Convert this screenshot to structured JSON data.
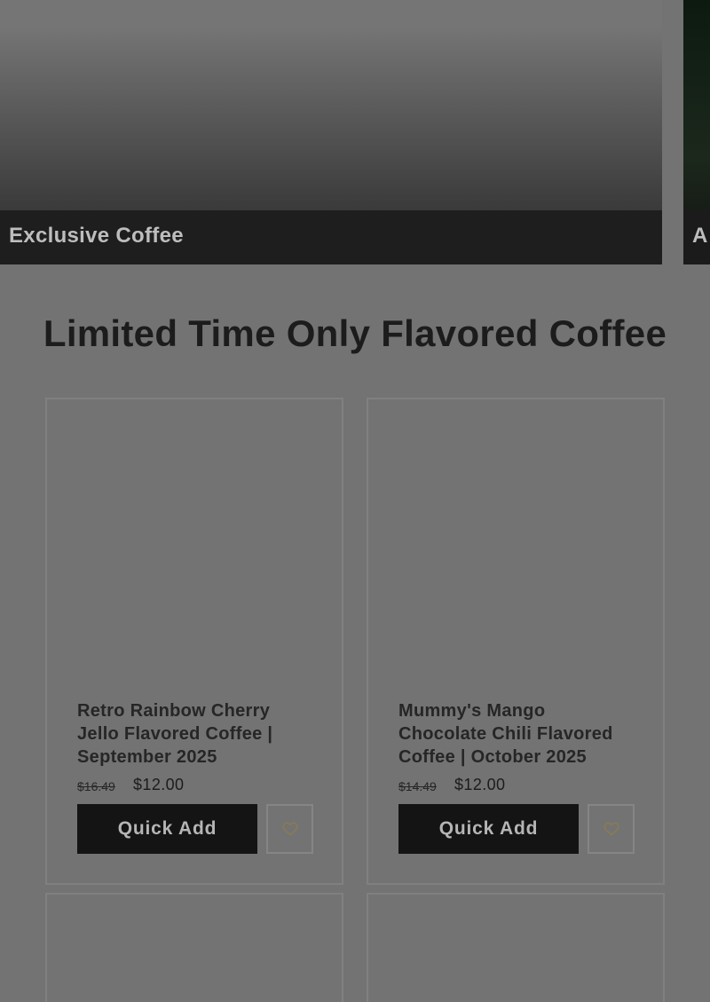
{
  "hero": {
    "main_caption": "Exclusive Coffee",
    "next_caption": "A"
  },
  "section": {
    "title": "Limited Time Only Flavored Coffee"
  },
  "products": [
    {
      "title": "Retro Rainbow Cherry Jello Flavored Coffee | September 2025",
      "old_price": "$16.49",
      "price": "$12.00",
      "button_label": "Quick Add",
      "wishlist_icon": "heart-icon"
    },
    {
      "title": "Mummy's Mango Chocolate Chili Flavored Coffee | October 2025",
      "old_price": "$14.49",
      "price": "$12.00",
      "button_label": "Quick Add",
      "wishlist_icon": "heart-icon"
    }
  ],
  "colors": {
    "overlay_background": "#737373",
    "button_background": "#141414",
    "heart_outline": "#8a7a55"
  }
}
